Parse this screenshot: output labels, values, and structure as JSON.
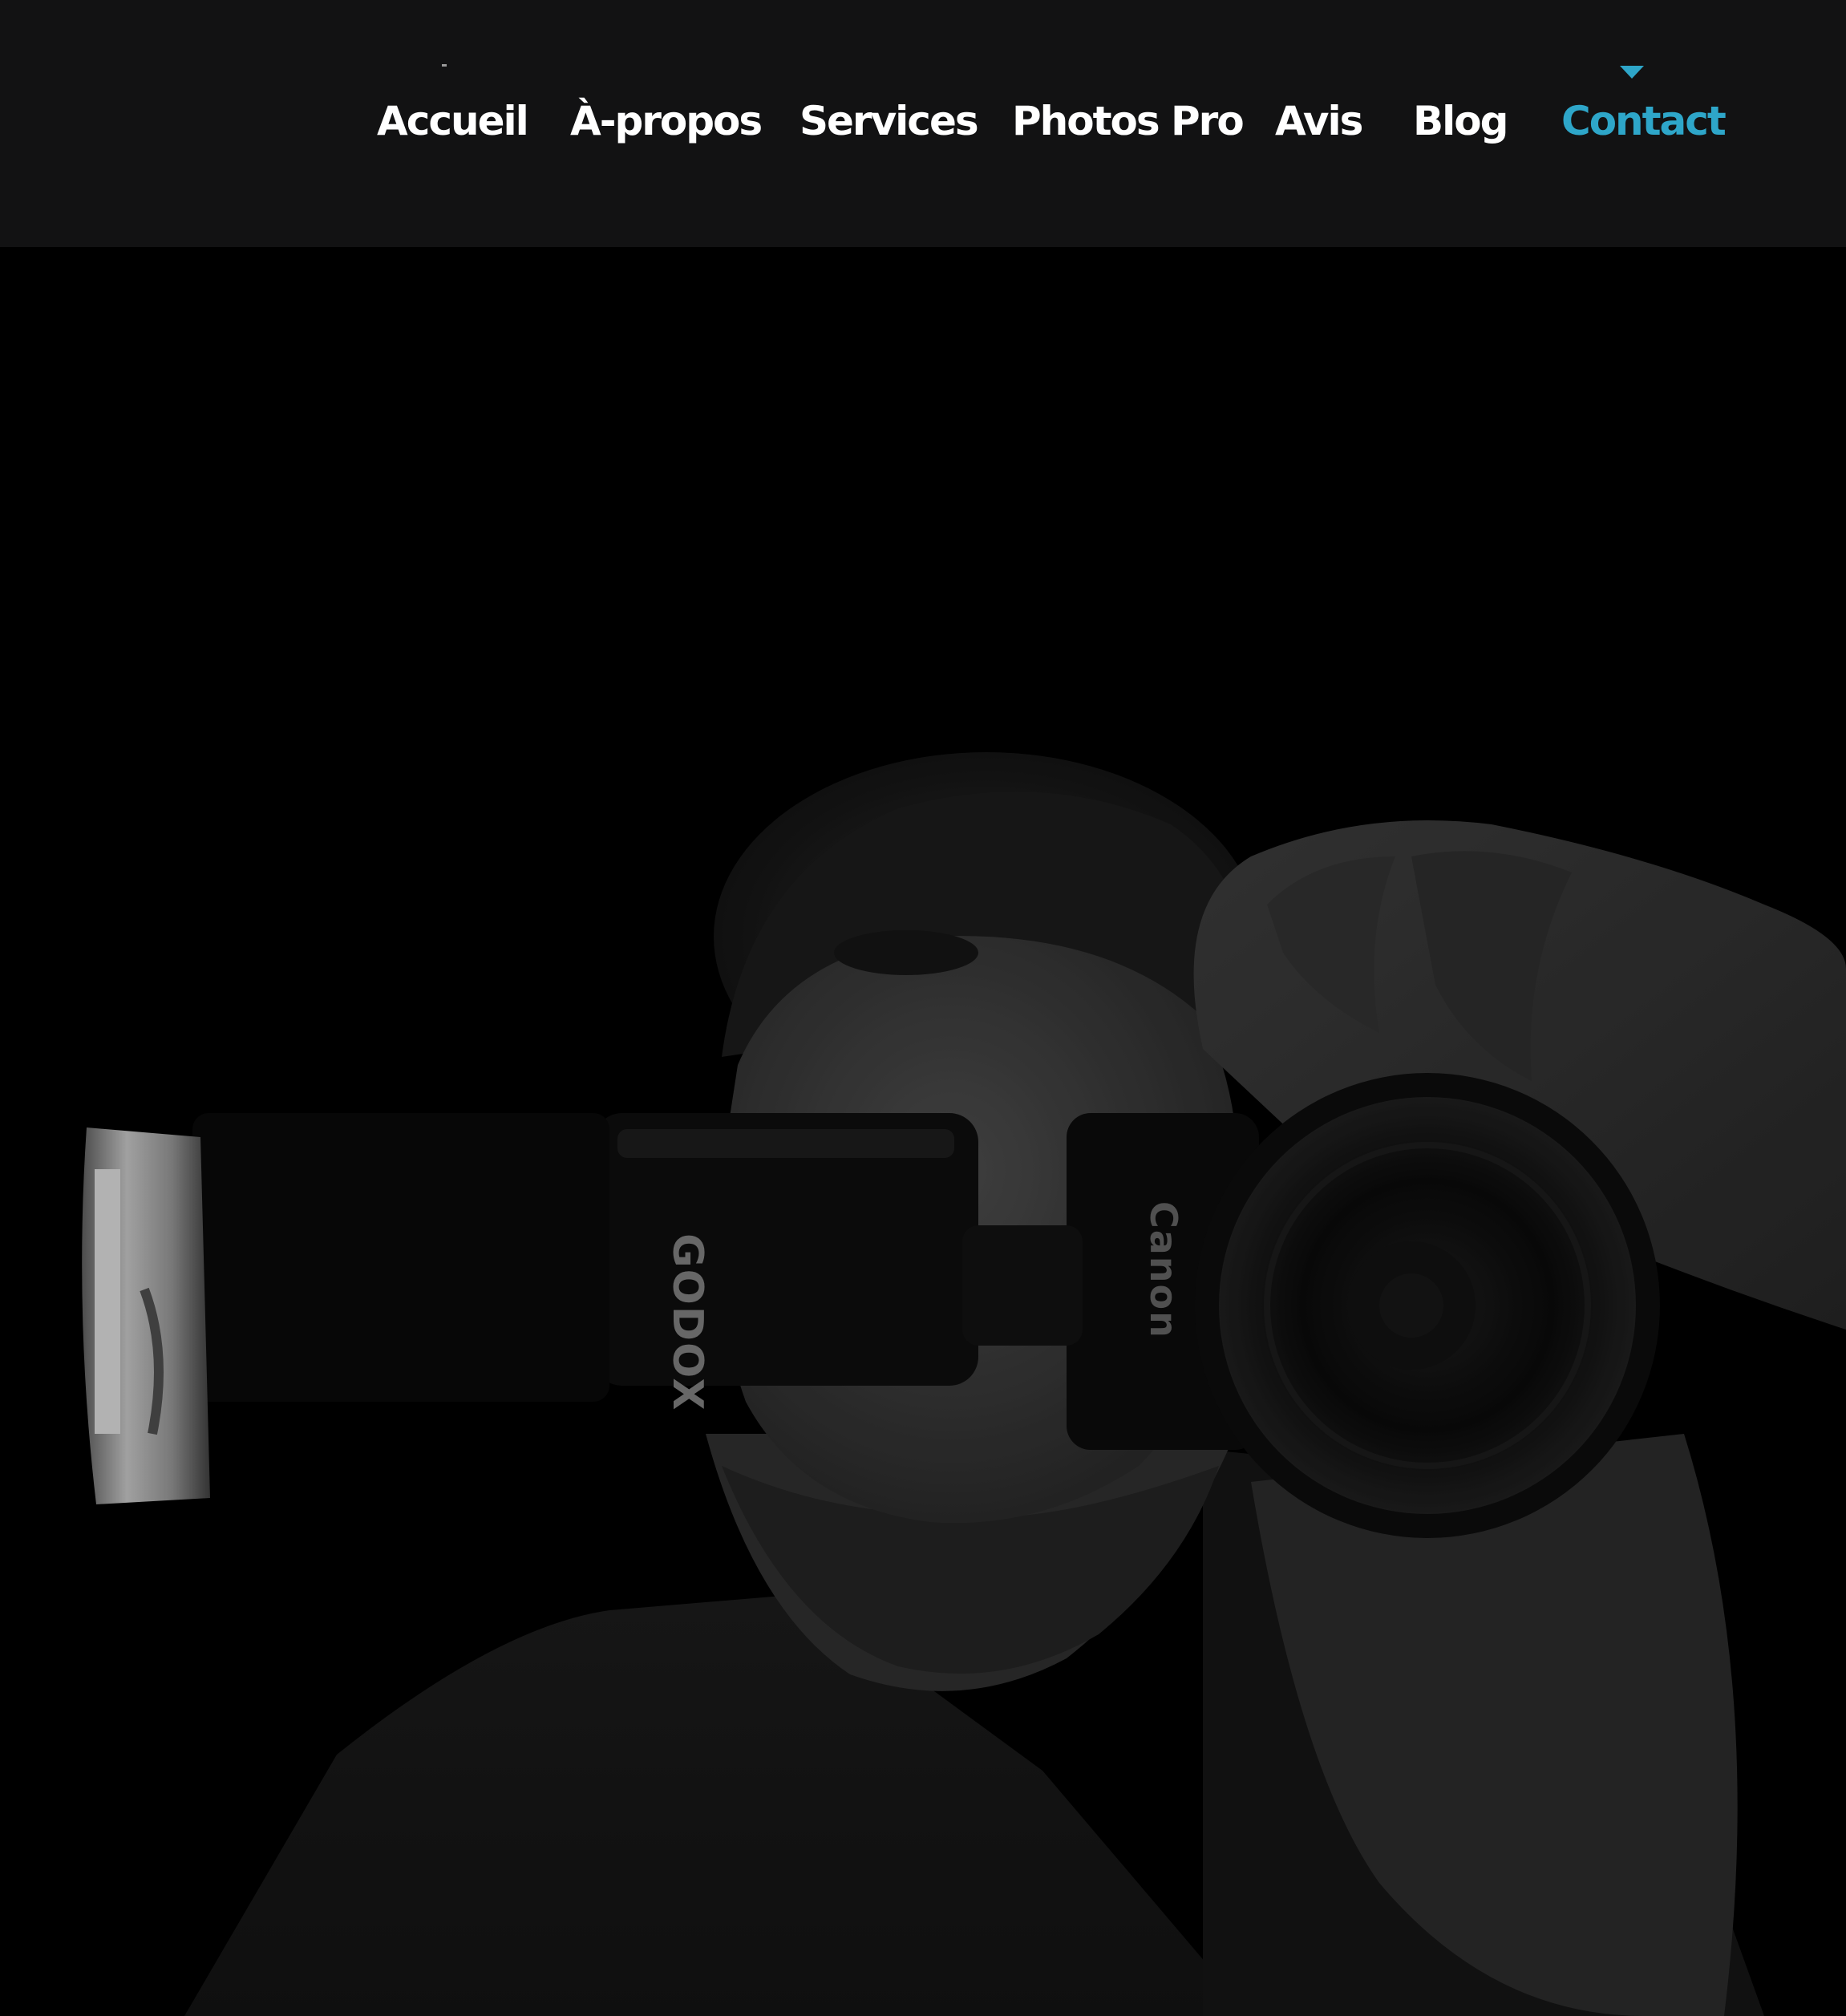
{
  "nav": {
    "items": [
      {
        "label": "Accueil",
        "active": false
      },
      {
        "label": "À-propos",
        "active": false
      },
      {
        "label": "Services",
        "active": false
      },
      {
        "label": "Photos Pro",
        "active": false
      },
      {
        "label": "Avis",
        "active": false
      },
      {
        "label": "Blog",
        "active": false
      },
      {
        "label": "Contact",
        "active": true
      }
    ],
    "active_indicator_icon": "triangle-down-icon"
  },
  "hero": {
    "image": "photographer-holding-camera-with-flash",
    "flash_brand": "GODOX",
    "camera_brand": "Canon"
  },
  "colors": {
    "header_bg": "#121213",
    "nav_text": "#ffffff",
    "accent": "#2ea6c9",
    "page_bg": "#000000"
  }
}
